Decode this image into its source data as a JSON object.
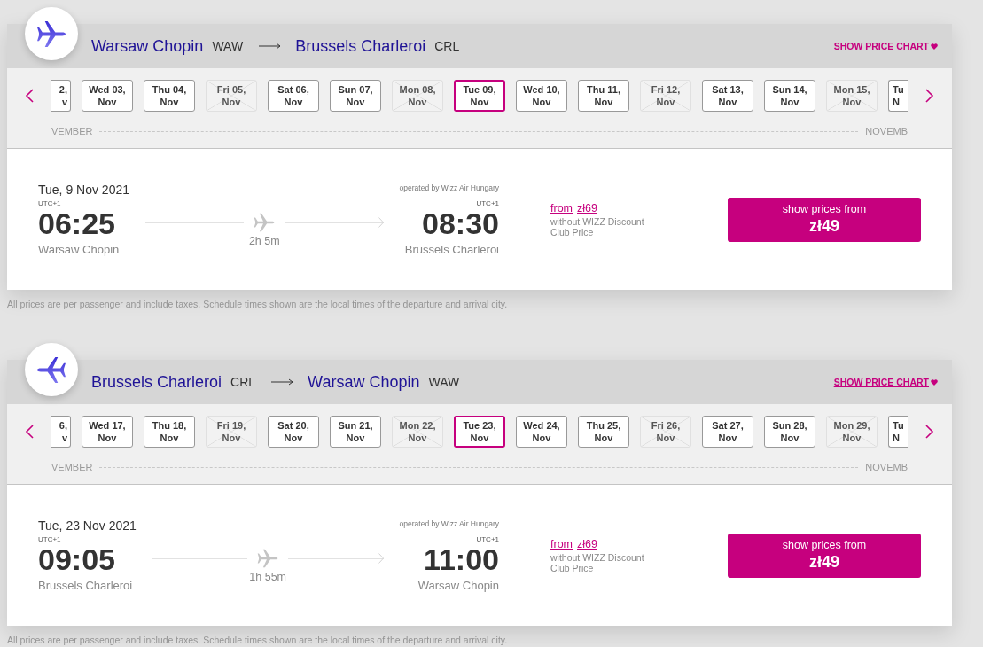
{
  "flights": [
    {
      "kind": "outbound",
      "route": {
        "origin": "Warsaw Chopin",
        "origin_code": "WAW",
        "destination": "Brussels Charleroi",
        "destination_code": "CRL"
      },
      "price_chart_link": "SHOW PRICE CHART",
      "dates": [
        {
          "kind": "cut_start",
          "day": "2,",
          "month": "v",
          "available": true,
          "selected": false
        },
        {
          "kind": "full",
          "day": "Wed 03,",
          "month": "Nov",
          "available": true,
          "selected": false
        },
        {
          "kind": "full",
          "day": "Thu 04,",
          "month": "Nov",
          "available": true,
          "selected": false
        },
        {
          "kind": "full",
          "day": "Fri 05,",
          "month": "Nov",
          "available": false,
          "selected": false
        },
        {
          "kind": "full",
          "day": "Sat 06,",
          "month": "Nov",
          "available": true,
          "selected": false
        },
        {
          "kind": "full",
          "day": "Sun 07,",
          "month": "Nov",
          "available": true,
          "selected": false
        },
        {
          "kind": "full",
          "day": "Mon 08,",
          "month": "Nov",
          "available": false,
          "selected": false
        },
        {
          "kind": "full",
          "day": "Tue 09,",
          "month": "Nov",
          "available": true,
          "selected": true
        },
        {
          "kind": "full",
          "day": "Wed 10,",
          "month": "Nov",
          "available": true,
          "selected": false
        },
        {
          "kind": "full",
          "day": "Thu 11,",
          "month": "Nov",
          "available": true,
          "selected": false
        },
        {
          "kind": "full",
          "day": "Fri 12,",
          "month": "Nov",
          "available": false,
          "selected": false
        },
        {
          "kind": "full",
          "day": "Sat 13,",
          "month": "Nov",
          "available": true,
          "selected": false
        },
        {
          "kind": "full",
          "day": "Sun 14,",
          "month": "Nov",
          "available": true,
          "selected": false
        },
        {
          "kind": "full",
          "day": "Mon 15,",
          "month": "Nov",
          "available": false,
          "selected": false
        },
        {
          "kind": "cut_end",
          "day": "Tu",
          "month": "N",
          "available": true,
          "selected": false
        }
      ],
      "month_labels": [
        "VEMBER",
        "NOVEMB"
      ],
      "details": {
        "date": "Tue, 9 Nov 2021",
        "departure": {
          "timezone": "UTC+1",
          "time": "06:25",
          "airport": "Warsaw Chopin"
        },
        "duration": "2h 5m",
        "operator": "operated by Wizz Air Hungary",
        "arrival": {
          "timezone": "UTC+1",
          "time": "08:30",
          "airport": "Brussels Charleroi"
        },
        "regular_price": {
          "label": "from",
          "amount": "zł69",
          "note": "without WIZZ Discount Club Price"
        },
        "button": {
          "label": "show prices from",
          "price": "zł49"
        }
      },
      "disclaimer": "All prices are per passenger and include taxes. Schedule times shown are the local times of the departure and arrival city."
    },
    {
      "kind": "return",
      "route": {
        "origin": "Brussels Charleroi",
        "origin_code": "CRL",
        "destination": "Warsaw Chopin",
        "destination_code": "WAW"
      },
      "price_chart_link": "SHOW PRICE CHART",
      "dates": [
        {
          "kind": "cut_start",
          "day": "6,",
          "month": "v",
          "available": true,
          "selected": false
        },
        {
          "kind": "full",
          "day": "Wed 17,",
          "month": "Nov",
          "available": true,
          "selected": false
        },
        {
          "kind": "full",
          "day": "Thu 18,",
          "month": "Nov",
          "available": true,
          "selected": false
        },
        {
          "kind": "full",
          "day": "Fri 19,",
          "month": "Nov",
          "available": false,
          "selected": false
        },
        {
          "kind": "full",
          "day": "Sat 20,",
          "month": "Nov",
          "available": true,
          "selected": false
        },
        {
          "kind": "full",
          "day": "Sun 21,",
          "month": "Nov",
          "available": true,
          "selected": false
        },
        {
          "kind": "full",
          "day": "Mon 22,",
          "month": "Nov",
          "available": false,
          "selected": false
        },
        {
          "kind": "full",
          "day": "Tue 23,",
          "month": "Nov",
          "available": true,
          "selected": true
        },
        {
          "kind": "full",
          "day": "Wed 24,",
          "month": "Nov",
          "available": true,
          "selected": false
        },
        {
          "kind": "full",
          "day": "Thu 25,",
          "month": "Nov",
          "available": true,
          "selected": false
        },
        {
          "kind": "full",
          "day": "Fri 26,",
          "month": "Nov",
          "available": false,
          "selected": false
        },
        {
          "kind": "full",
          "day": "Sat 27,",
          "month": "Nov",
          "available": true,
          "selected": false
        },
        {
          "kind": "full",
          "day": "Sun 28,",
          "month": "Nov",
          "available": true,
          "selected": false
        },
        {
          "kind": "full",
          "day": "Mon 29,",
          "month": "Nov",
          "available": false,
          "selected": false
        },
        {
          "kind": "cut_end",
          "day": "Tu",
          "month": "N",
          "available": true,
          "selected": false
        }
      ],
      "month_labels": [
        "VEMBER",
        "NOVEMB"
      ],
      "details": {
        "date": "Tue, 23 Nov 2021",
        "departure": {
          "timezone": "UTC+1",
          "time": "09:05",
          "airport": "Brussels Charleroi"
        },
        "duration": "1h 55m",
        "operator": "operated by Wizz Air Hungary",
        "arrival": {
          "timezone": "UTC+1",
          "time": "11:00",
          "airport": "Warsaw Chopin"
        },
        "regular_price": {
          "label": "from",
          "amount": "zł69",
          "note": "without WIZZ Discount Club Price"
        },
        "button": {
          "label": "show prices from",
          "price": "zł49"
        }
      },
      "disclaimer": "All prices are per passenger and include taxes. Schedule times shown are the local times of the departure and arrival city."
    }
  ]
}
